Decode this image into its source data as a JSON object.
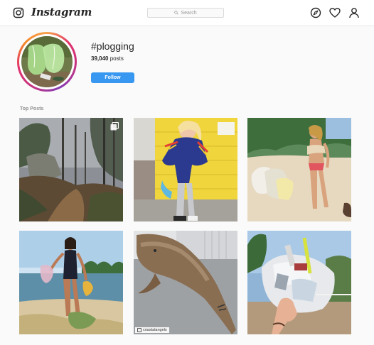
{
  "header": {
    "brand": "Instagram",
    "search_placeholder": "Search",
    "icons": [
      "instagram-glyph-icon",
      "compass-icon",
      "heart-icon",
      "user-icon"
    ]
  },
  "tag": {
    "name": "#plogging",
    "posts_count": "39,040",
    "posts_label": "posts",
    "follow_label": "Follow"
  },
  "top_posts": {
    "title": "Top Posts",
    "tiles": [
      {
        "subject": "forest-path-photo",
        "multi": true
      },
      {
        "subject": "woman-yellow-wall-photo"
      },
      {
        "subject": "woman-beach-trash-photo"
      },
      {
        "subject": "woman-swimsuit-beach-photo"
      },
      {
        "subject": "dolphin-photo",
        "credit": "coastalangels"
      },
      {
        "subject": "hand-plastic-waste-photo"
      }
    ]
  },
  "colors": {
    "accent": "#3897f0",
    "ring_start": "#f58529",
    "ring_end": "#833ab4"
  }
}
